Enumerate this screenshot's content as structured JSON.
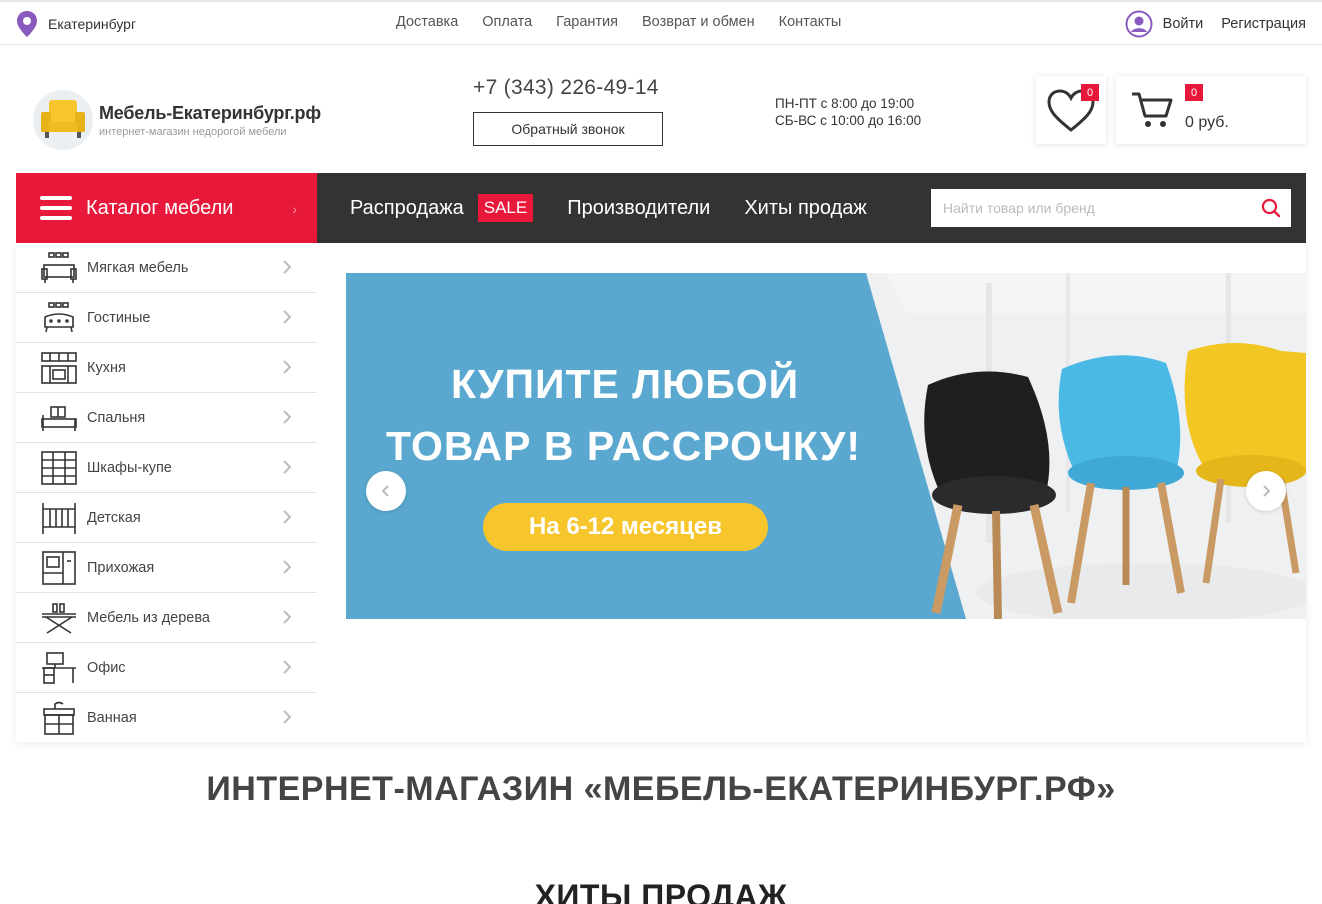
{
  "topbar": {
    "city": "Екатеринбург",
    "nav": [
      "Доставка",
      "Оплата",
      "Гарантия",
      "Возврат и обмен",
      "Контакты"
    ],
    "login": "Войти",
    "register": "Регистрация"
  },
  "header": {
    "logo_title": "Мебель-Екатеринбург.рф",
    "logo_subtitle": "интернет-магазин недорогой мебели",
    "phone": "+7 (343) 226-49-14",
    "callback_label": "Обратный звонок",
    "hours_weekday": "ПН-ПТ с 8:00 до 19:00",
    "hours_weekend": "СБ-ВС с 10:00 до 16:00",
    "favorites_count": "0",
    "cart_count": "0",
    "cart_sum": "0 руб."
  },
  "mainnav": {
    "catalog_label": "Каталог мебели",
    "sale_label": "Распродажа",
    "sale_badge": "SALE",
    "manufacturers": "Производители",
    "bestsellers": "Хиты продаж",
    "search_placeholder": "Найти товар или бренд"
  },
  "categories": [
    {
      "label": "Мягкая мебель",
      "icon": "sofa-icon"
    },
    {
      "label": "Гостиные",
      "icon": "living-room-icon"
    },
    {
      "label": "Кухня",
      "icon": "kitchen-icon"
    },
    {
      "label": "Спальня",
      "icon": "bed-icon"
    },
    {
      "label": "Шкафы-купе",
      "icon": "wardrobe-icon"
    },
    {
      "label": "Детская",
      "icon": "crib-icon"
    },
    {
      "label": "Прихожая",
      "icon": "hallway-icon"
    },
    {
      "label": "Мебель из дерева",
      "icon": "wood-furniture-icon"
    },
    {
      "label": "Офис",
      "icon": "office-icon"
    },
    {
      "label": "Ванная",
      "icon": "bathroom-icon"
    }
  ],
  "banner": {
    "line1": "КУПИТЕ ЛЮБОЙ",
    "line2": "ТОВАР В РАССРОЧКУ!",
    "pill": "На 6-12 месяцев"
  },
  "page_heading": "ИНТЕРНЕТ-МАГАЗИН «МЕБЕЛЬ-ЕКАТЕРИНБУРГ.РФ»",
  "section_heading": "ХИТЫ ПРОДАЖ",
  "colors": {
    "accent_red": "#e8183a",
    "nav_dark": "#333333",
    "banner_blue": "#5aa8cf",
    "banner_yellow": "#f7c52c",
    "pin_purple": "#8a5bbf"
  }
}
